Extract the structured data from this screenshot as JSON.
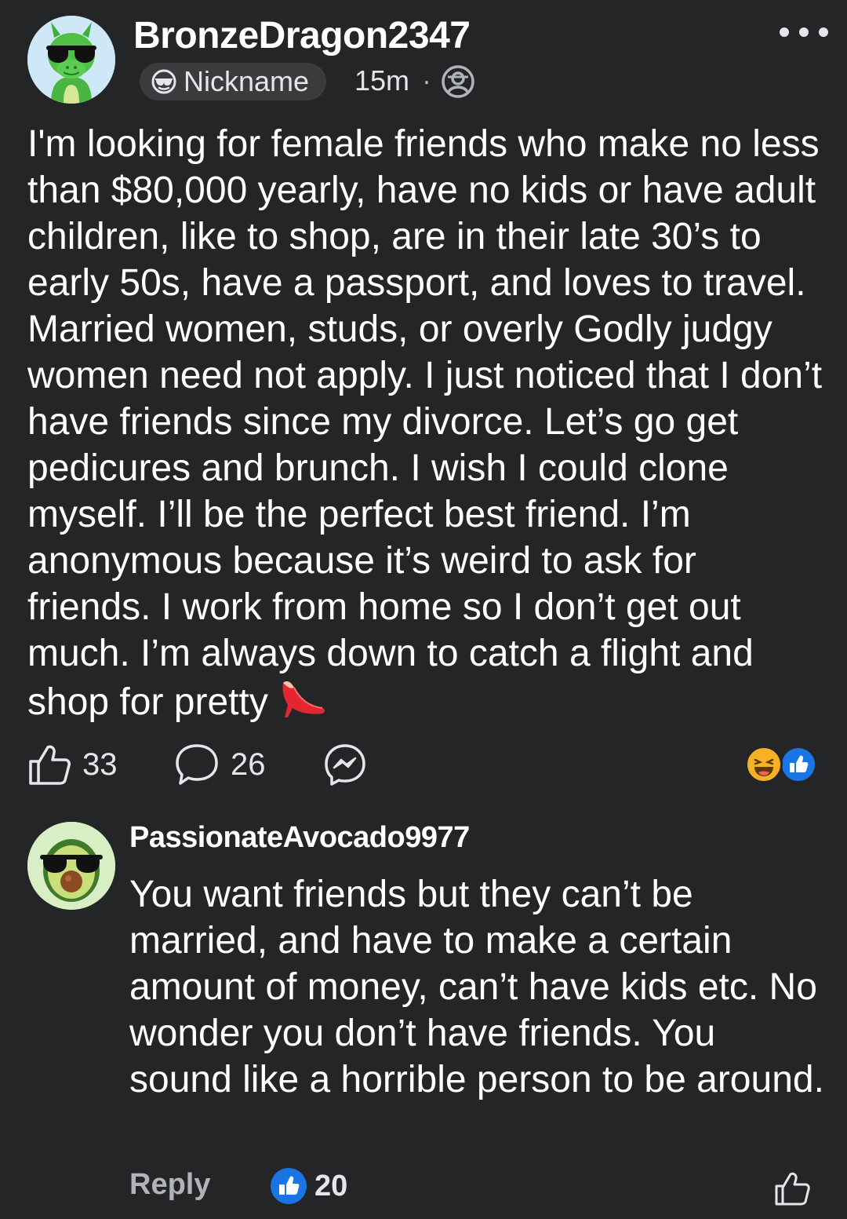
{
  "colors": {
    "background": "#242526",
    "text_primary": "#ffffff",
    "text_secondary": "#b0b3b8",
    "accent_blue": "#1b74e4",
    "haha_yellow": "#f7b125"
  },
  "post": {
    "author": {
      "name": "BronzeDragon2347",
      "avatar_icon": "dragon-with-sunglasses-avatar"
    },
    "nickname_badge": {
      "icon": "sunglasses-icon",
      "label": "Nickname"
    },
    "timestamp": "15m",
    "separator": "·",
    "privacy_icon": "anonymous-user-icon",
    "more_icon": "more-dots-icon",
    "text": "I'm looking for female friends who make no less than $80,000 yearly, have no kids or have adult children, like to shop, are in their late 30’s to early 50s, have a passport, and loves to travel. Married women, studs, or overly Godly judgy women need not apply. I just noticed that I don’t have friends since my divorce. Let’s go get pedicures and brunch. I wish I could clone myself. I’ll be the perfect best friend. I’m anonymous because it’s weird to ask for friends. I work from home so I don’t get out much. I’m always down to catch a flight and shop for pretty",
    "trailing_emoji": "high-heel-shoe-icon",
    "actions": {
      "like": {
        "icon": "thumbs-up-icon",
        "count": "33"
      },
      "comment": {
        "icon": "comment-bubble-icon",
        "count": "26"
      },
      "share": {
        "icon": "messenger-icon"
      }
    },
    "reactions": [
      "haha-reaction-icon",
      "like-reaction-icon"
    ]
  },
  "comment": {
    "author": {
      "name": "PassionateAvocado9977",
      "avatar_icon": "avocado-with-sunglasses-avatar"
    },
    "text": "You want friends but they can’t be married, and have to make a certain amount of money, can’t have kids etc. No wonder you don’t have friends. You sound like a horrible person to be around.",
    "reply_label": "Reply",
    "like_count": "20",
    "like_badge_icon": "like-reaction-icon",
    "like_button_icon": "thumbs-up-icon"
  }
}
